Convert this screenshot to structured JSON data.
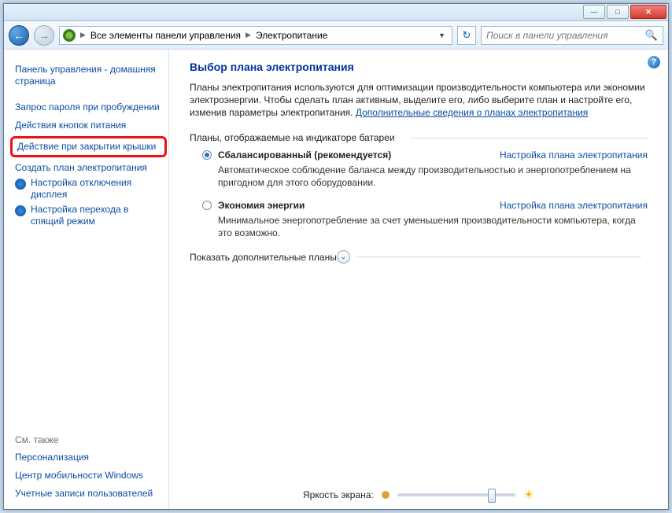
{
  "breadcrumb": {
    "item1": "Все элементы панели управления",
    "item2": "Электропитание"
  },
  "search": {
    "placeholder": "Поиск в панели управления"
  },
  "sidebar": {
    "home": "Панель управления - домашняя страница",
    "items": [
      "Запрос пароля при пробуждении",
      "Действия кнопок питания",
      "Действие при закрытии крышки",
      "Создать план электропитания",
      "Настройка отключения дисплея",
      "Настройка перехода в спящий режим"
    ],
    "see_also_h": "См. также",
    "see_also": [
      "Персонализация",
      "Центр мобильности Windows",
      "Учетные записи пользователей"
    ]
  },
  "main": {
    "title": "Выбор плана электропитания",
    "intro_a": "Планы электропитания используются для оптимизации производительности компьютера или экономии электроэнергии. Чтобы сделать план активным, выделите его, либо выберите план и настройте его, изменив параметры электропитания. ",
    "intro_link": "Дополнительные сведения о планах электропитания",
    "group_label": "Планы, отображаемые на индикаторе батареи",
    "plans": [
      {
        "name": "Сбалансированный (рекомендуется)",
        "desc": "Автоматическое соблюдение баланса между производительностью и энергопотреблением на пригодном для этого оборудовании.",
        "selected": true
      },
      {
        "name": "Экономия энергии",
        "desc": "Минимальное энергопотребление за счет уменьшения производительности компьютера, когда это возможно.",
        "selected": false
      }
    ],
    "plan_link": "Настройка плана электропитания",
    "expander": "Показать дополнительные планы",
    "brightness_label": "Яркость экрана:"
  }
}
